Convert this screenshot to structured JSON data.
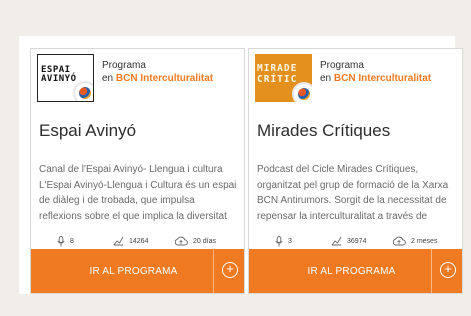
{
  "colors": {
    "accent": "#f07a22",
    "page_bg": "#f1eeea",
    "card_border": "#d9d9d9"
  },
  "cards": [
    {
      "thumb_text": "ESPAI\nAVINYÓ",
      "program_label": "Programa",
      "program_prefix": "en",
      "program_org": "BCN Interculturalitat",
      "title": "Espai Avinyó",
      "description": "Canal de l'Espai Avinyó- Llengua i cultura L'Espai Avinyó-Llengua i Cultura és un espai de diàleg i de trobada, que impulsa reflexions sobre el que implica la diversitat cultural en tots els àmbits",
      "episodes": "8",
      "plays": "14264",
      "updated": "20 días",
      "cta_label": "IR AL PROGRAMA",
      "icons": {
        "episodes": "microphone-icon",
        "plays": "chart-icon",
        "updated": "cloud-upload-icon",
        "plus": "plus-circle-icon"
      }
    },
    {
      "thumb_text": "MIRADE\nCRÍTIC",
      "program_label": "Programa",
      "program_prefix": "en",
      "program_org": "BCN Interculturalitat",
      "title": "Mirades Crítiques",
      "description": "Podcast del Cicle Mirades Crítiques, organitzat pel grup de formació de la Xarxa BCN Antirumors. Sorgit de la necessitat de repensar la interculturalitat a través de diverses",
      "episodes": "3",
      "plays": "36974",
      "updated": "2 meses",
      "cta_label": "IR AL PROGRAMA",
      "icons": {
        "episodes": "microphone-icon",
        "plays": "chart-icon",
        "updated": "cloud-upload-icon",
        "plus": "plus-circle-icon"
      }
    }
  ]
}
